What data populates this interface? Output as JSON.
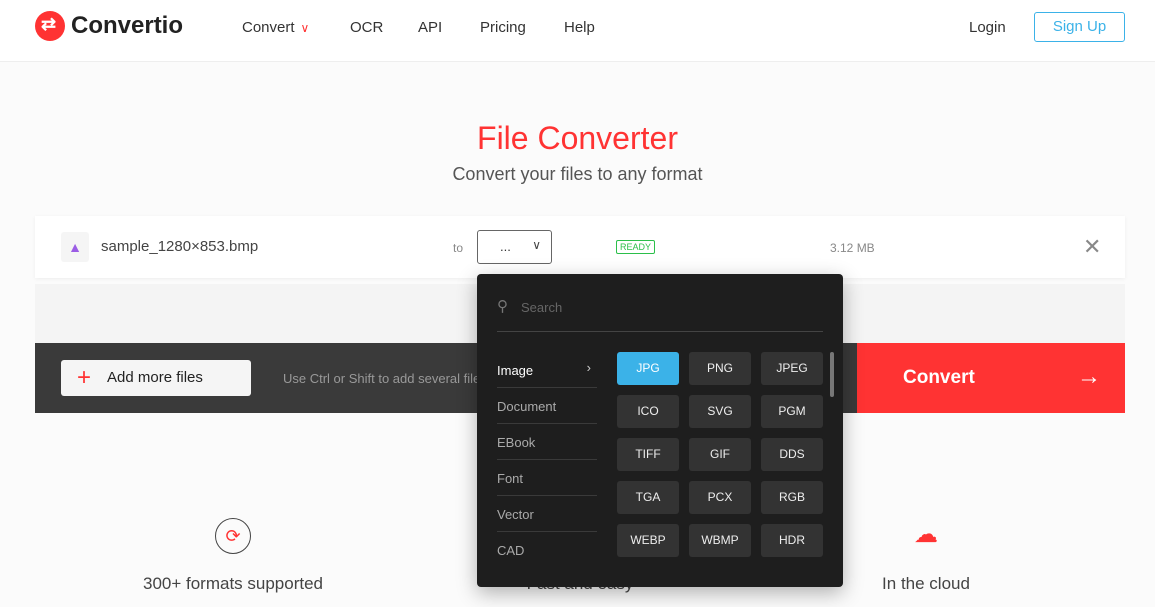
{
  "header": {
    "brand": "Convertio",
    "nav": [
      "Convert",
      "OCR",
      "API",
      "Pricing",
      "Help"
    ],
    "login": "Login",
    "signup": "Sign Up"
  },
  "hero": {
    "title": "File Converter",
    "subtitle": "Convert your files to any format"
  },
  "file": {
    "name": "sample_1280×853.bmp",
    "to": "to",
    "selected": "...",
    "status": "READY",
    "size": "3.12 MB"
  },
  "actions": {
    "add_more": "Add more files",
    "hint": "Use Ctrl or Shift to add several files at once",
    "convert": "Convert"
  },
  "dropdown": {
    "search_placeholder": "Search",
    "categories": [
      "Image",
      "Document",
      "EBook",
      "Font",
      "Vector",
      "CAD"
    ],
    "active_category": "Image",
    "formats": [
      "JPG",
      "PNG",
      "JPEG",
      "ICO",
      "SVG",
      "PGM",
      "TIFF",
      "GIF",
      "DDS",
      "TGA",
      "PCX",
      "RGB",
      "WEBP",
      "WBMP",
      "HDR"
    ],
    "active_format": "JPG"
  },
  "features": [
    "300+ formats supported",
    "Fast and easy",
    "In the cloud"
  ],
  "colors": {
    "accent": "#ff3333",
    "blue": "#3bb2e8",
    "ready": "#2bbf4a"
  }
}
